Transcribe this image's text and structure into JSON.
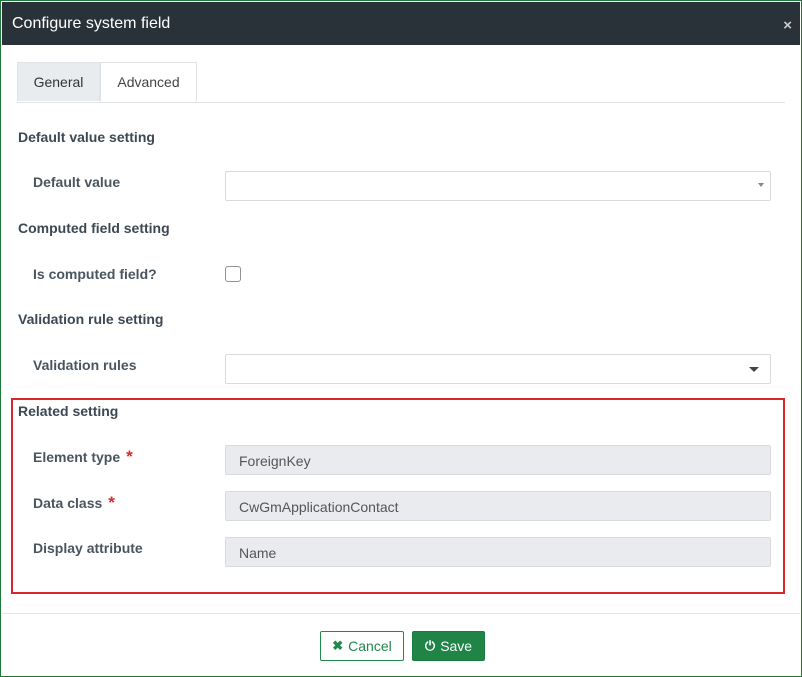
{
  "dialog": {
    "title": "Configure system field",
    "close_glyph": "×"
  },
  "tabs": [
    {
      "label": "General"
    },
    {
      "label": "Advanced"
    }
  ],
  "sections": {
    "default_value": {
      "heading": "Default value setting",
      "label": "Default value",
      "value": ""
    },
    "computed": {
      "heading": "Computed field setting",
      "label": "Is computed field?",
      "checked": false
    },
    "validation": {
      "heading": "Validation rule setting",
      "label": "Validation rules",
      "value": ""
    },
    "related": {
      "heading": "Related setting",
      "element_type": {
        "label": "Element type",
        "required": "*",
        "value": "ForeignKey"
      },
      "data_class": {
        "label": "Data class",
        "required": "*",
        "value": "CwGmApplicationContact"
      },
      "display_attribute": {
        "label": "Display attribute",
        "value": "Name"
      }
    }
  },
  "footer": {
    "cancel": {
      "icon": "✖",
      "label": "Cancel"
    },
    "save": {
      "icon": "⏻",
      "label": "Save"
    }
  },
  "colors": {
    "titlebar": "#2a3239",
    "primary": "#1f8446",
    "highlight_border": "#d9262c"
  }
}
